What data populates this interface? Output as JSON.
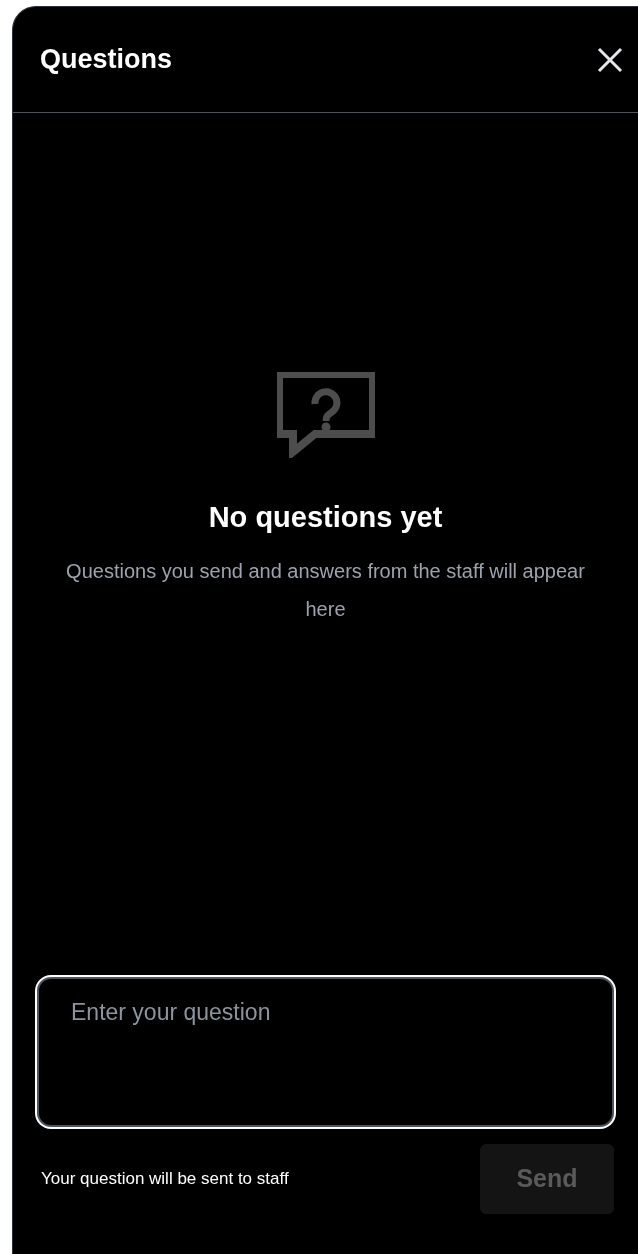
{
  "header": {
    "title": "Questions"
  },
  "empty_state": {
    "title": "No questions yet",
    "message": "Questions you send and answers from the staff will appear here"
  },
  "question_field": {
    "placeholder": "Enter your question",
    "focused": true
  },
  "footer": {
    "hint": "Your question will be sent to staff",
    "send_button": {
      "label": "Send",
      "disabled": true
    }
  }
}
